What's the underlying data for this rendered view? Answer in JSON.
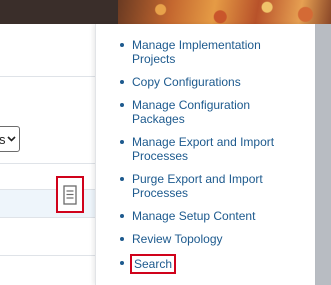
{
  "menu": {
    "items": [
      {
        "label": "Manage Implementation Projects"
      },
      {
        "label": "Copy Configurations"
      },
      {
        "label": "Manage Configuration Packages"
      },
      {
        "label": "Manage Export and Import Processes"
      },
      {
        "label": "Purge Export and Import Processes"
      },
      {
        "label": "Manage Setup Content"
      },
      {
        "label": "Review Topology"
      },
      {
        "label": "Search"
      }
    ]
  },
  "left": {
    "select_value": "s",
    "select_icon": "chevron-down-icon",
    "doc_icon": "document-list-icon"
  },
  "colors": {
    "link": "#1d5a8e",
    "highlight_border": "#d0021b"
  }
}
